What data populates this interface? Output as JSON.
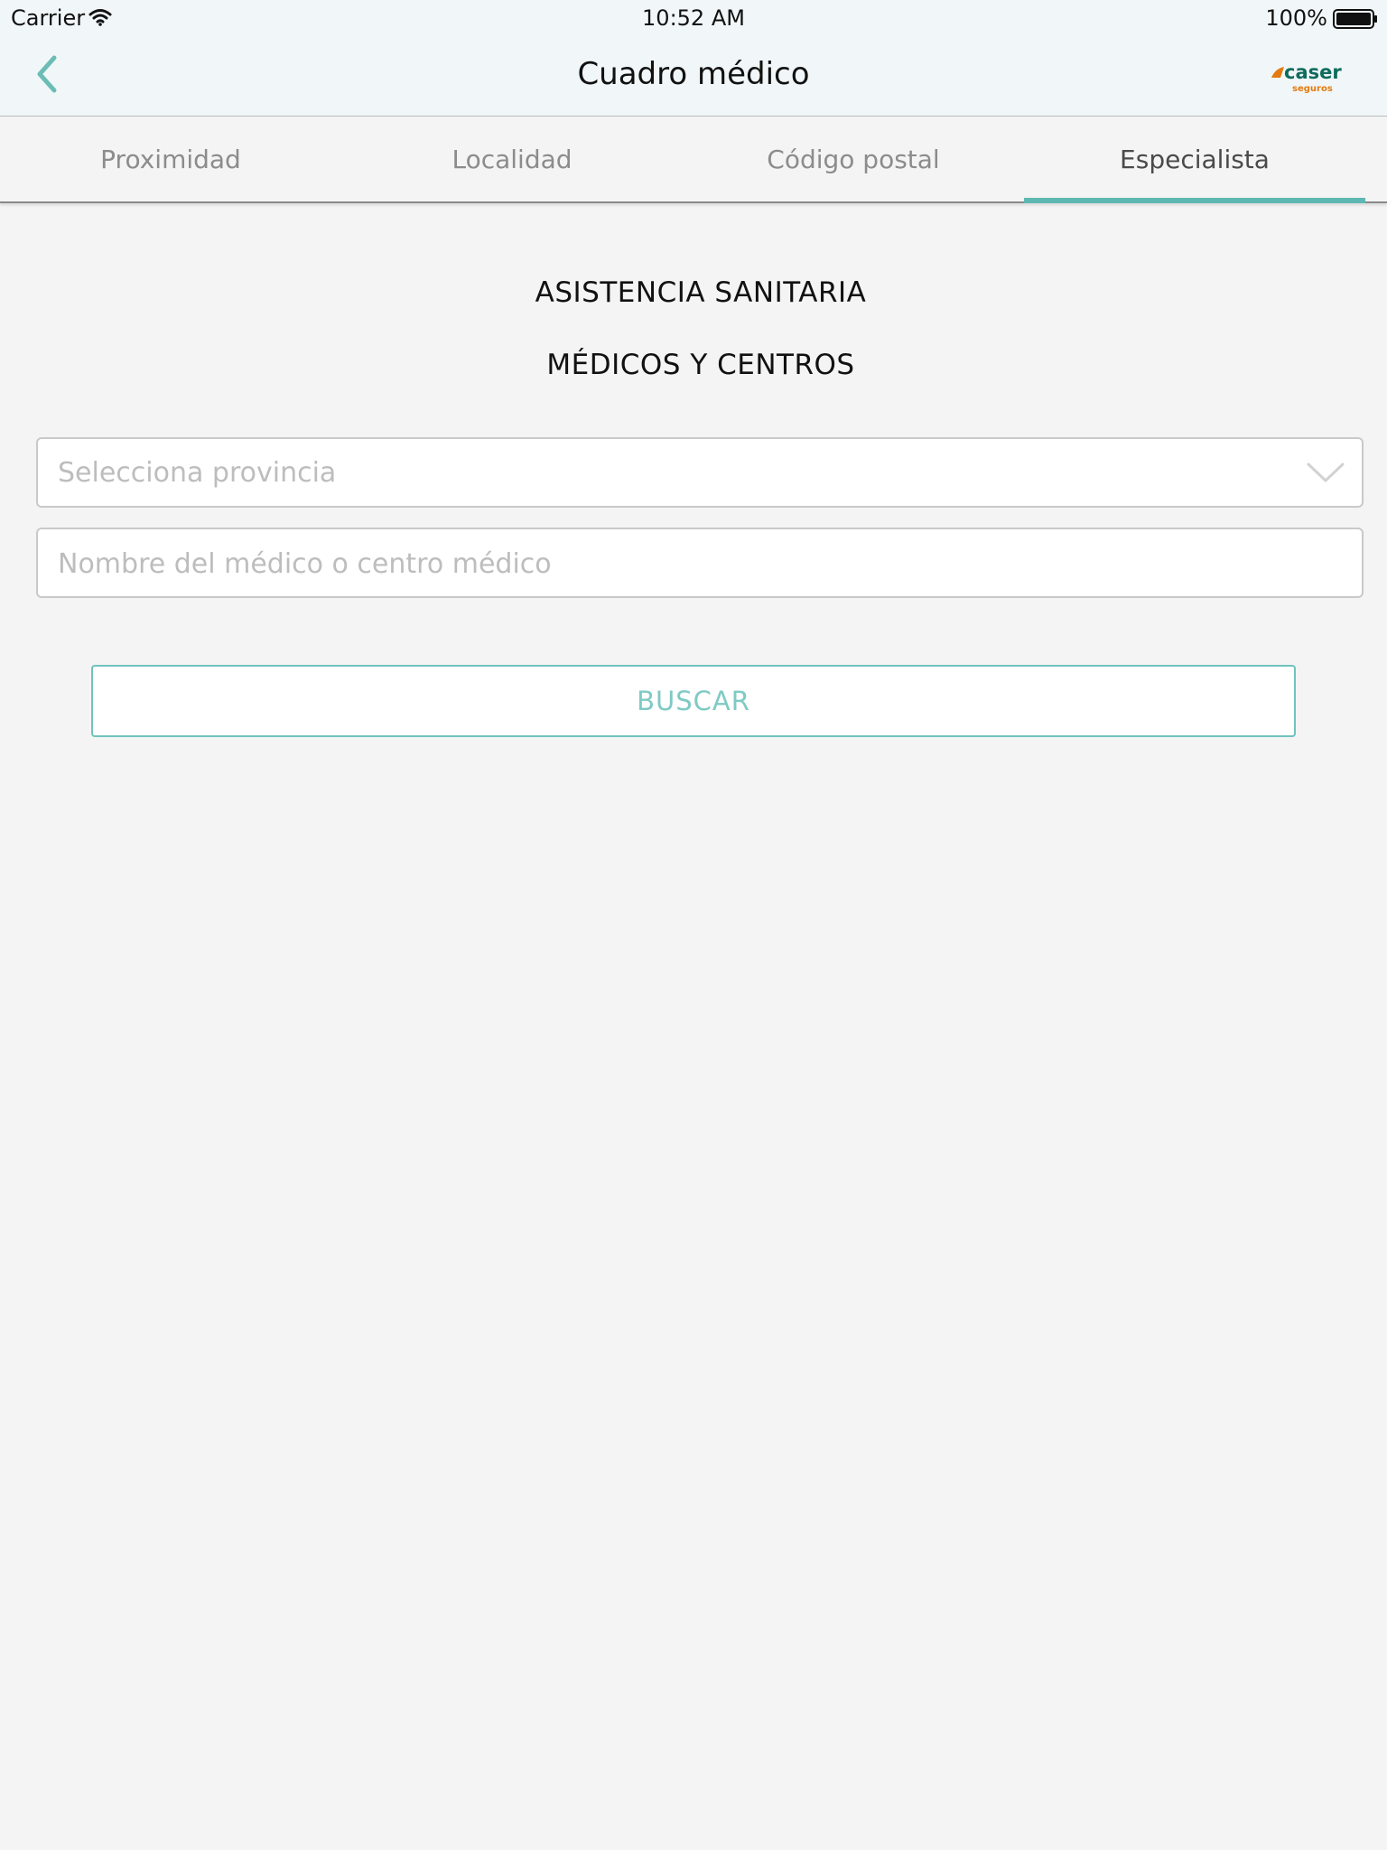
{
  "status_bar": {
    "carrier": "Carrier",
    "time": "10:52 AM",
    "battery": "100%",
    "icons": [
      "wifi-icon",
      "battery-icon"
    ]
  },
  "nav_bar": {
    "title": "Cuadro médico",
    "back_icon": "chevron-left-icon",
    "logo": {
      "brand": "caser",
      "tagline": "seguros",
      "brand_color": "#0e6b5e",
      "accent_color": "#e47a10"
    }
  },
  "tabs": [
    {
      "label": "Proximidad",
      "active": false
    },
    {
      "label": "Localidad",
      "active": false
    },
    {
      "label": "Código postal",
      "active": false
    },
    {
      "label": "Especialista",
      "active": true
    }
  ],
  "main": {
    "heading_1": "ASISTENCIA SANITARIA",
    "heading_2": "MÉDICOS Y CENTROS",
    "province_select": {
      "placeholder": "Selecciona provincia",
      "icon": "chevron-down-icon"
    },
    "name_input": {
      "placeholder": "Nombre del médico o centro médico",
      "value": ""
    },
    "search_button": "BUSCAR"
  },
  "colors": {
    "accent": "#5db8b2",
    "button_text": "#7fcac4",
    "background": "#f4f4f4",
    "nav_background": "#f1f7f8"
  }
}
